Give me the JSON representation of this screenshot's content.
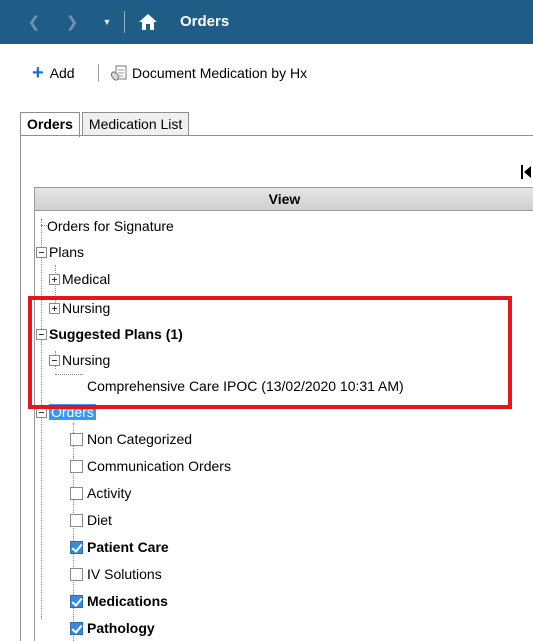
{
  "titlebar": {
    "title": "Orders",
    "back_glyph": "❮",
    "forward_glyph": "❯",
    "dropdown_glyph": "▼"
  },
  "toolbar": {
    "add_label": "Add",
    "separator": "|",
    "document_label": "Document Medication by Hx"
  },
  "tabs": [
    {
      "label": "Orders",
      "active": true
    },
    {
      "label": "Medication List",
      "active": false
    }
  ],
  "view": {
    "header": "View",
    "items": {
      "orders_for_signature": "Orders for Signature",
      "plans": "Plans",
      "medical": "Medical",
      "nursing_1": "Nursing",
      "suggested_plans": "Suggested Plans (1)",
      "nursing_2": "Nursing",
      "comprehensive": "Comprehensive Care IPOC (13/02/2020 10:31 AM)",
      "orders": "Orders",
      "non_categorized": "Non Categorized",
      "communication_orders": "Communication Orders",
      "activity": "Activity",
      "diet": "Diet",
      "patient_care": "Patient Care",
      "iv_solutions": "IV Solutions",
      "medications": "Medications",
      "pathology": "Pathology"
    }
  },
  "colors": {
    "titlebar": "#1f5c86",
    "highlight": "#e8141b",
    "selection": "#3399ff",
    "checkbox_on": "#3b8ad6"
  },
  "icons": [
    "back-arrow-icon",
    "forward-arrow-icon",
    "dropdown-icon",
    "home-icon",
    "plus-icon",
    "document-medication-icon",
    "collapse-panel-icon"
  ]
}
